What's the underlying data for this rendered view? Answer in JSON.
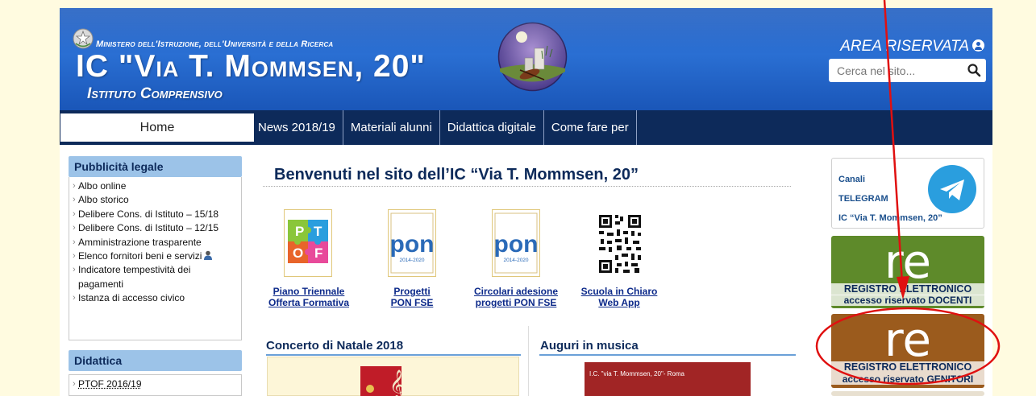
{
  "header": {
    "ministry": "Ministero dell'Istruzione, dell'Università e della Ricerca",
    "school_name": "IC \"Via T. Mommsen, 20\"",
    "school_type": "Istituto Comprensivo",
    "area_riservata": "AREA RISERVATA",
    "search_placeholder": "Cerca nel sito..."
  },
  "nav": {
    "home": "Home",
    "items": [
      "News 2018/19",
      "Materiali alunni",
      "Didattica digitale",
      "Come fare per"
    ]
  },
  "sidebar": {
    "pubblicita_title": "Pubblicità legale",
    "pubblicita_items": [
      "Albo online",
      "Albo storico",
      "Delibere Cons. di Istituto – 15/18",
      "Delibere Cons. di Istituto – 12/15",
      "Amministrazione trasparente",
      "Elenco fornitori beni e servizi",
      "Indicatore tempestività dei pagamenti",
      "Istanza di accesso civico"
    ],
    "didattica_title": "Didattica",
    "didattica_items": [
      "PTOF 2016/19"
    ]
  },
  "main": {
    "welcome": "Benvenuti nel sito dell’IC “Via T. Mommsen, 20”",
    "tiles": [
      {
        "label1": "Piano Triennale",
        "label2": "Offerta Formativa",
        "icon": "ptof-puzzle-icon"
      },
      {
        "label1": "Progetti",
        "label2": "PON FSE",
        "icon": "pon-logo-icon"
      },
      {
        "label1": "Circolari adesione",
        "label2": "progetti PON FSE",
        "icon": "pon-logo-icon"
      },
      {
        "label1": "Scuola in Chiaro",
        "label2": "Web App",
        "icon": "qr-code-icon"
      }
    ],
    "pon_word": "pon",
    "pon_years": "2014-2020",
    "ptof_letters": [
      "P",
      "T",
      "O",
      "F"
    ],
    "concerto_title": "Concerto di Natale 2018",
    "auguri_title": "Auguri in musica",
    "auguri_caption": "I.C. \"via T. Mommsen, 20\"- Roma"
  },
  "right": {
    "telegram_lines": [
      "Canali",
      "TELEGRAM",
      "IC “Via T. Mommsen, 20”"
    ],
    "re_docenti_1": "REGISTRO ELETTRONICO",
    "re_docenti_2": "accesso riservato DOCENTI",
    "re_genitori_1": "REGISTRO ELETTRONICO",
    "re_genitori_2": "accesso riservato GENITORI",
    "re_mark": "re"
  },
  "colors": {
    "header_blue": "#1d5cc0",
    "nav_navy": "#0d2a5a",
    "sidebar_head": "#9cc3e8",
    "re_green": "#5e8a2a",
    "re_brown": "#9b5b1d",
    "telegram_blue": "#2a9ede",
    "annotation_red": "#e01010"
  }
}
